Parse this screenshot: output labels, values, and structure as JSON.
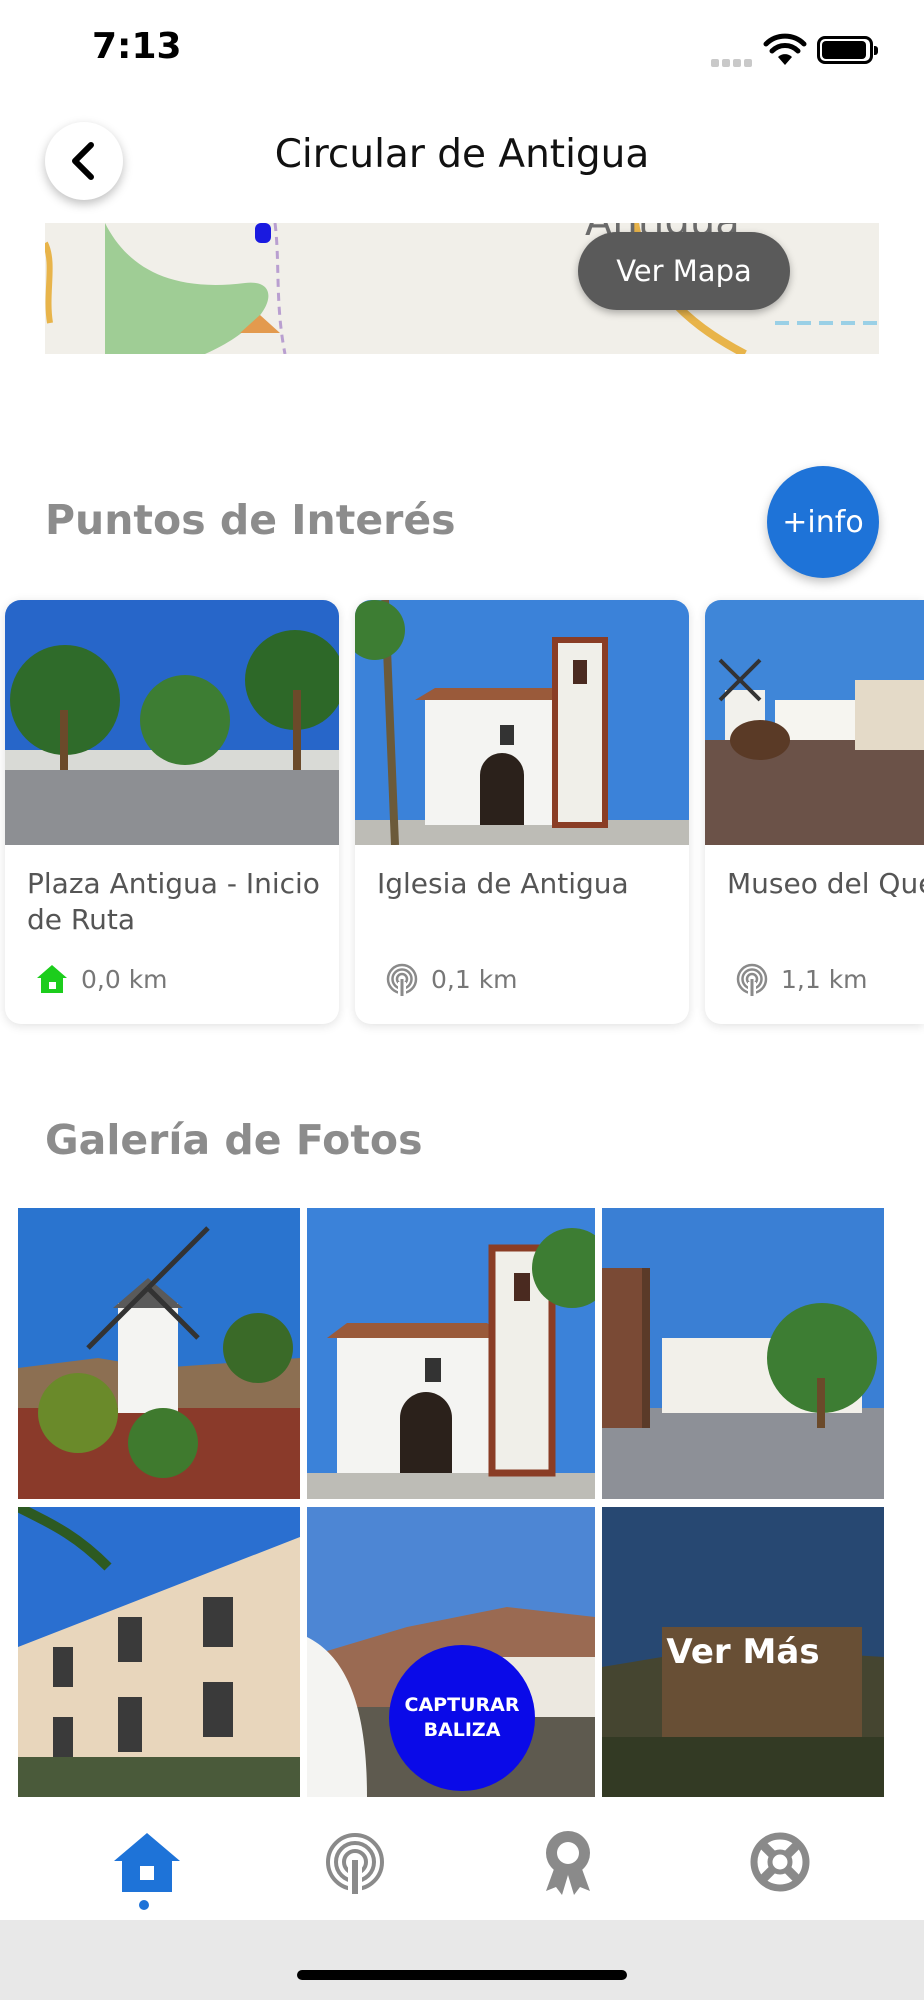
{
  "status": {
    "time": "7:13"
  },
  "header": {
    "title": "Circular de Antigua"
  },
  "map": {
    "button_label": "Ver Mapa",
    "place_label": "Antigua"
  },
  "points_of_interest": {
    "heading": "Puntos de Interés",
    "info_button": "+info",
    "items": [
      {
        "title": "Plaza Antigua - Inicio de Ruta",
        "distance": "0,0 km",
        "icon": "home-icon",
        "icon_color": "#1ccd1c"
      },
      {
        "title": "Iglesia de Antigua",
        "distance": "0,1 km",
        "icon": "beacon-icon"
      },
      {
        "title": "Museo del Que Majorero - ...",
        "distance": "1,1 km",
        "icon": "beacon-icon"
      }
    ]
  },
  "gallery": {
    "heading": "Galería de Fotos",
    "more_label": "Ver Más"
  },
  "capture_button": {
    "line1": "CAPTURAR",
    "line2": "BALIZA"
  },
  "tabs": [
    {
      "name": "home",
      "icon": "home-icon",
      "active": true
    },
    {
      "name": "beacons",
      "icon": "beacon-icon"
    },
    {
      "name": "awards",
      "icon": "award-icon"
    },
    {
      "name": "help",
      "icon": "lifebuoy-icon"
    }
  ],
  "colors": {
    "accent": "#1e73d8",
    "capture": "#0a0ae8",
    "heading": "#8c8c8c"
  }
}
